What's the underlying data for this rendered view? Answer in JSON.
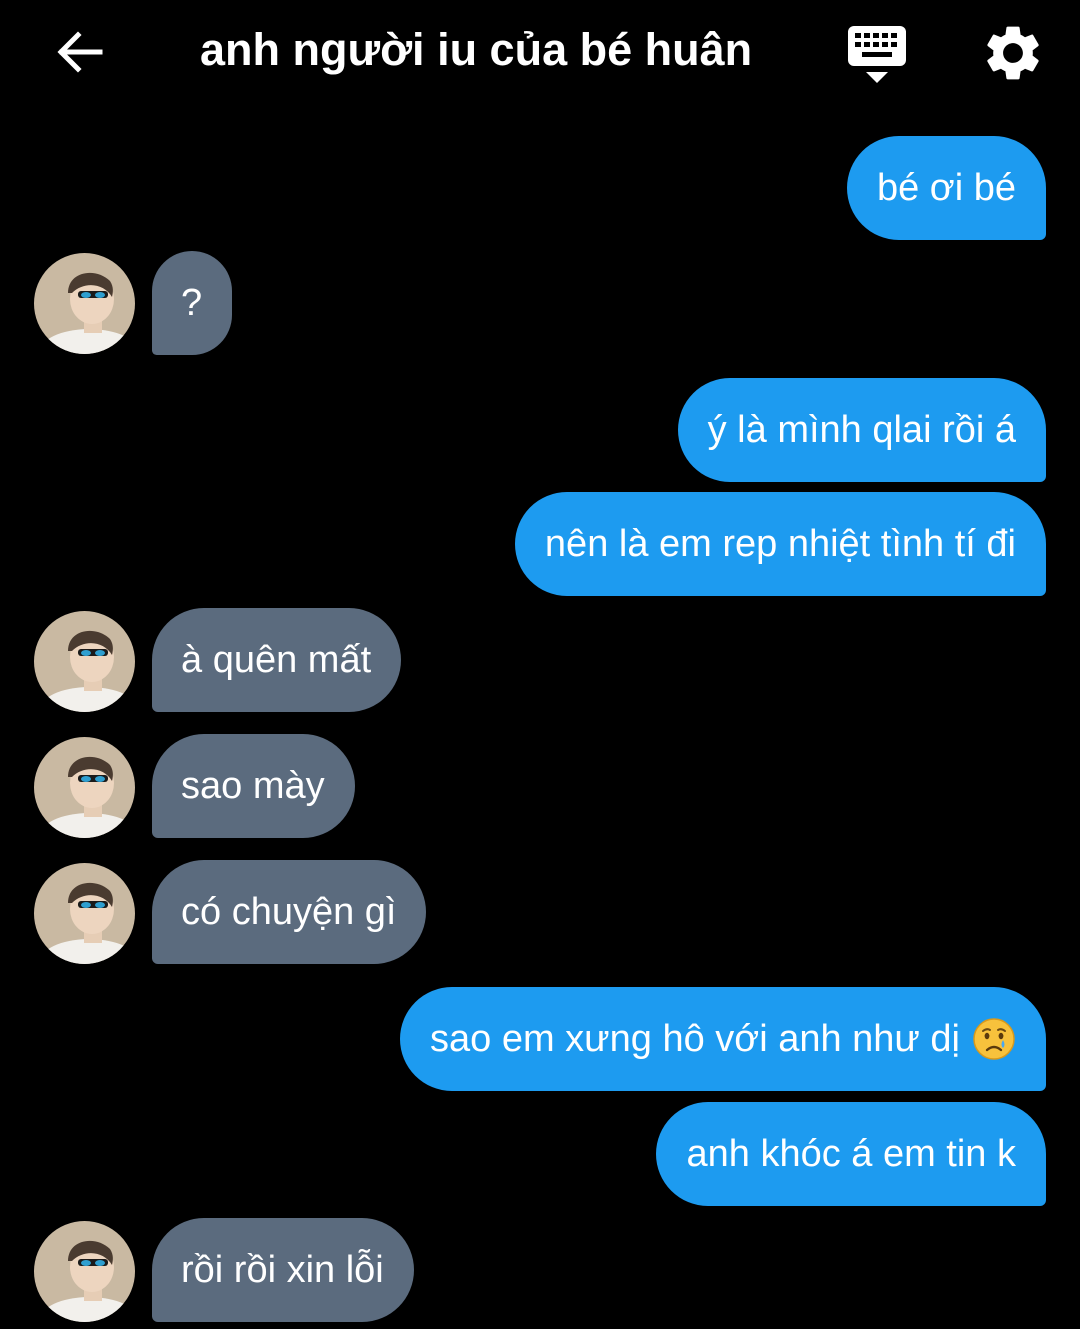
{
  "header": {
    "title": "anh người iu của bé huân",
    "back_icon": "arrow-left-icon",
    "keyboard_icon": "keyboard-icon",
    "settings_icon": "gear-icon"
  },
  "colors": {
    "background": "#000000",
    "outgoing_bubble": "#1d9bf0",
    "incoming_bubble": "#5b6b7e",
    "text": "#ffffff"
  },
  "messages": [
    {
      "side": "me",
      "text": "bé ơi bé"
    },
    {
      "side": "them",
      "text": "?"
    },
    {
      "side": "me",
      "text": "ý là mình qlai rồi á"
    },
    {
      "side": "me",
      "text": "nên là em rep nhiệt tình tí đi"
    },
    {
      "side": "them",
      "text": "à quên mất"
    },
    {
      "side": "them",
      "text": "sao mày"
    },
    {
      "side": "them",
      "text": "có chuyện gì"
    },
    {
      "side": "me",
      "text": "sao em xưng hô với anh như dị",
      "emoji": "crying-face-emoji"
    },
    {
      "side": "me",
      "text": "anh khóc á em tin k"
    },
    {
      "side": "them",
      "text": "rồi rồi xin lỗi"
    }
  ]
}
